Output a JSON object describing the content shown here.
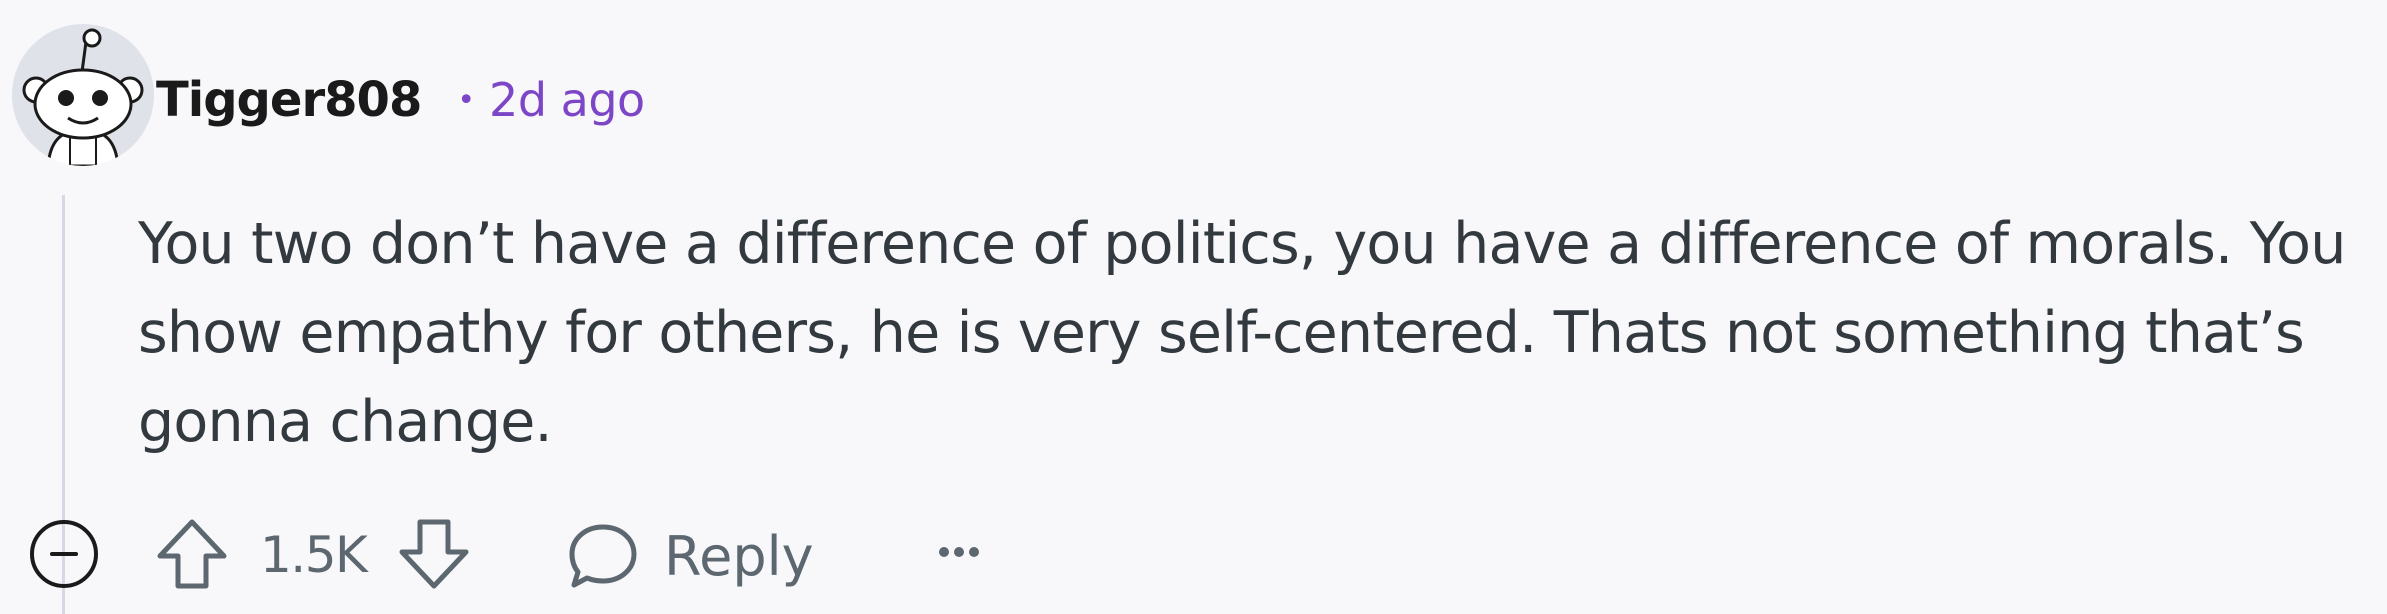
{
  "comment": {
    "username": "Tigger808",
    "separator": "•",
    "timestamp": "2d ago",
    "body": "You two don’t have a difference of politics, you have a difference of morals. You show empathy for others, he is very self-centered. Thats not something that’s gonna change."
  },
  "actions": {
    "score": "1.5K",
    "reply_label": "Reply"
  },
  "icons": {
    "avatar": "snoo-avatar",
    "collapse": "minus-circle-icon",
    "upvote": "upvote-arrow-icon",
    "downvote": "downvote-arrow-icon",
    "reply": "speech-bubble-icon",
    "more": "ellipsis-icon"
  },
  "colors": {
    "background": "#f8f8fb",
    "timestamp": "#7c46c6",
    "thread_line": "#d7d7e6",
    "icon": "#5c6770"
  }
}
